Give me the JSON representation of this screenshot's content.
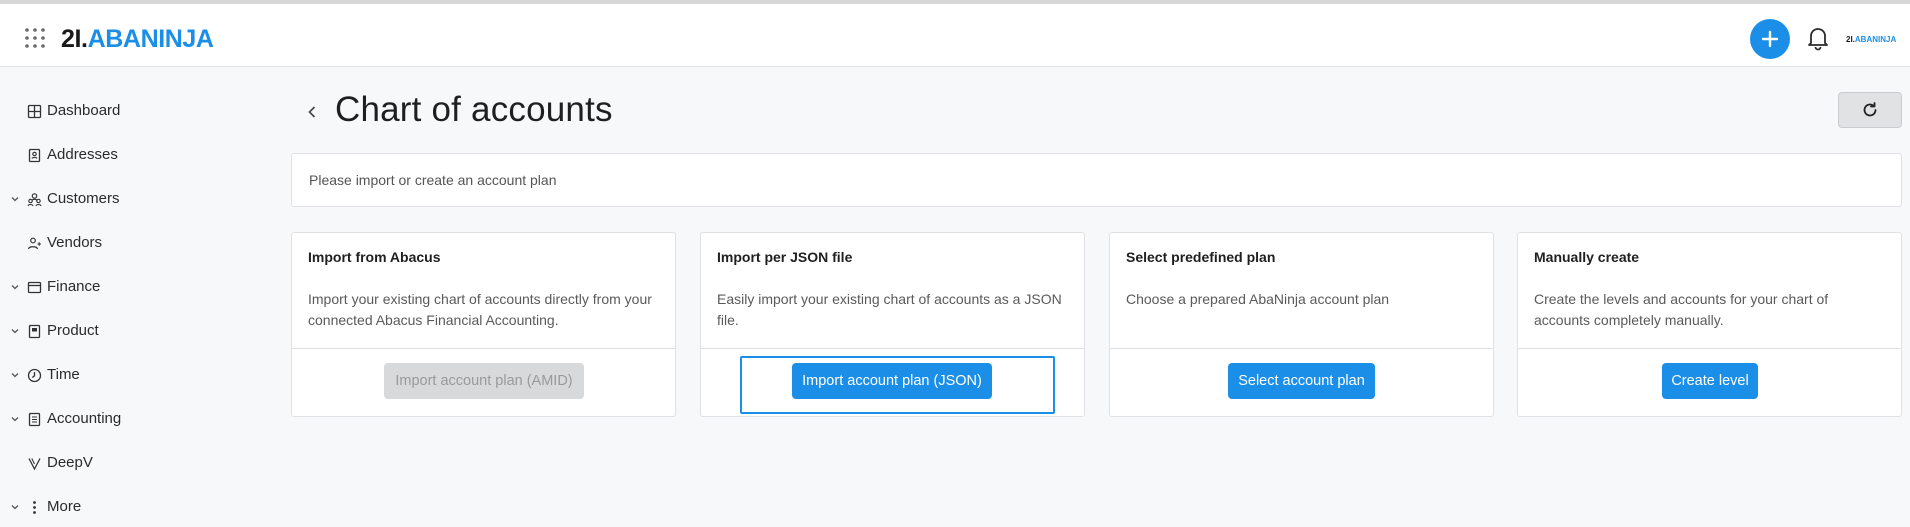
{
  "header": {
    "logo_part1": "2I.",
    "logo_part2": "ABANINJA",
    "org_logo_part1": "2I.",
    "org_logo_part2": "ABANINJA",
    "icons": [
      "apps-grid-icon",
      "plus-icon",
      "bell-icon"
    ]
  },
  "sidebar": {
    "items": [
      {
        "label": "Dashboard",
        "icon": "dashboard-icon",
        "expandable": false
      },
      {
        "label": "Addresses",
        "icon": "address-book-icon",
        "expandable": false
      },
      {
        "label": "Customers",
        "icon": "customers-icon",
        "expandable": true
      },
      {
        "label": "Vendors",
        "icon": "vendors-icon",
        "expandable": false
      },
      {
        "label": "Finance",
        "icon": "finance-icon",
        "expandable": true
      },
      {
        "label": "Product",
        "icon": "product-icon",
        "expandable": true
      },
      {
        "label": "Time",
        "icon": "clock-icon",
        "expandable": true
      },
      {
        "label": "Accounting",
        "icon": "accounting-icon",
        "expandable": true
      },
      {
        "label": "DeepV",
        "icon": "deepv-icon",
        "expandable": false
      },
      {
        "label": "More",
        "icon": "more-vertical-icon",
        "expandable": true
      }
    ]
  },
  "main": {
    "title": "Chart of accounts",
    "notice": "Please import or create an account plan",
    "cards": [
      {
        "title": "Import from Abacus",
        "description": "Import your existing chart of accounts directly from your connected Abacus Financial Accounting.",
        "button": "Import account plan (AMID)",
        "button_state": "disabled"
      },
      {
        "title": "Import per JSON file",
        "description": "Easily import your existing chart of accounts as a JSON file.",
        "button": "Import account plan (JSON)",
        "button_state": "focused"
      },
      {
        "title": "Select predefined plan",
        "description": "Choose a prepared AbaNinja account plan",
        "button": "Select account plan",
        "button_state": "enabled"
      },
      {
        "title": "Manually create",
        "description": "Create the levels and accounts for your chart of accounts completely manually.",
        "button": "Create level",
        "button_state": "enabled"
      }
    ]
  },
  "colors": {
    "accent": "#1b8fe8",
    "disabled_button": "#d8d9db",
    "background": "#f7f8fa"
  }
}
